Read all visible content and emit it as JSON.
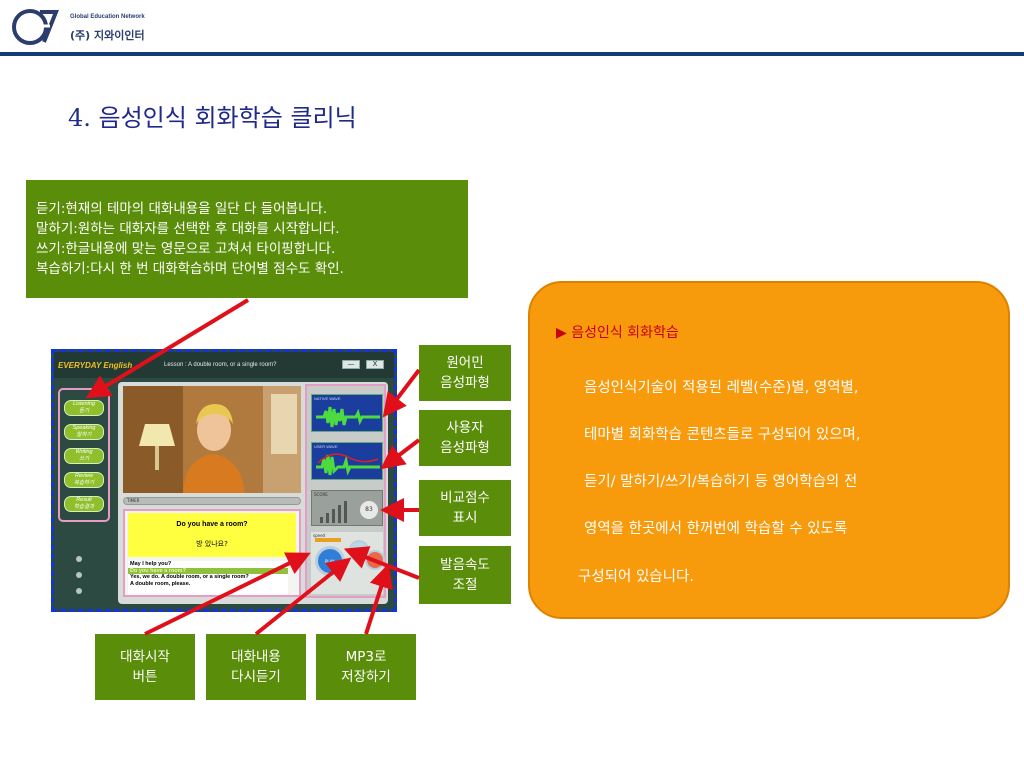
{
  "header": {
    "brand_small": "Global Education Network",
    "brand_name": "(주) 지와이인터"
  },
  "page_title": "4. 음성인식 회화학습 클리닉",
  "top_description": [
    "듣기:현재의 테마의 대화내용을 일단 다 들어봅니다.",
    "말하기:원하는 대화자를 선택한 후 대화를 시작합니다.",
    "쓰기:한글내용에 맞는 영문으로 고쳐서 타이핑합니다.",
    "복습하기:다시 한 번 대화학습하며 단어별 점수도 확인."
  ],
  "callouts": {
    "native_wave": [
      "원어민",
      "음성파형"
    ],
    "user_wave": [
      "사용자",
      "음성파형"
    ],
    "score": [
      "비교점수",
      "표시"
    ],
    "speed": [
      "발음속도",
      "조절"
    ],
    "start": [
      "대화시작",
      "버튼"
    ],
    "replay": [
      "대화내용",
      "다시듣기"
    ],
    "mp3": [
      "MP3로",
      "저장하기"
    ]
  },
  "feature_box": {
    "title": "▶ 음성인식 회화학습",
    "lines": [
      "음성인식기술이 적용된 레벨(수준)별, 영역별,",
      "테마별 회화학습 콘텐츠들로 구성되어 있으며,",
      "듣기/ 말하기/쓰기/복습하기 등 영어학습의 전",
      "영역을 한곳에서 한꺼번에 학습할 수 있도록",
      "구성되어 있습니다."
    ]
  },
  "app": {
    "logo": "EVERYDAY English",
    "lesson_title": "Lesson : A double room, or a single room?",
    "minimize_label": "—",
    "close_label": "X",
    "sidebar": [
      {
        "en": "Listening",
        "ko": "듣기"
      },
      {
        "en": "Speaking",
        "ko": "말하기"
      },
      {
        "en": "Writing",
        "ko": "쓰기"
      },
      {
        "en": "Review",
        "ko": "복습하기"
      },
      {
        "en": "Result",
        "ko": "학습결과"
      }
    ],
    "timer_label": "TIMER",
    "question_en": "Do you have a room?",
    "question_ko": "방 있나요?",
    "dialog": [
      "May I help you?",
      "Do you have a room?",
      "Yes, we do. A double room, or a single room?",
      "A double room, please."
    ],
    "native_wave_label": "NATIVE WAVE",
    "user_wave_label": "USER WAVE",
    "score_label": "SCORE",
    "score_value": "83",
    "speed_label": "speed",
    "play_label": "PLAY",
    "footer": "COPYRIGHT (C) 2007 ALL RIGHT RESERVED"
  },
  "colors": {
    "green": "#5a8d0a",
    "orange": "#f79a0c",
    "title_blue": "#1f2a8a",
    "arrow_red": "#e0101a",
    "dash_blue": "#1234d8"
  }
}
